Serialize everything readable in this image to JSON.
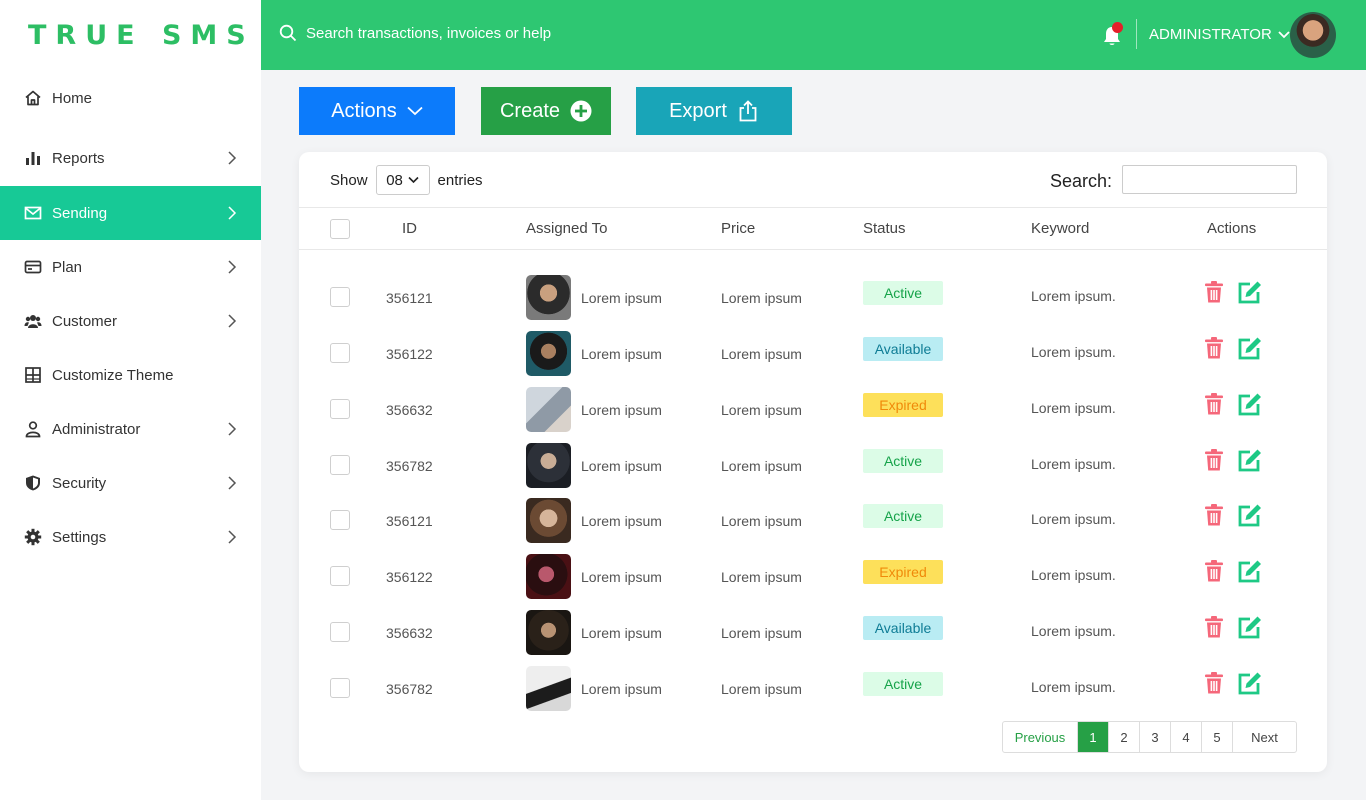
{
  "brand": "TRUE SMS",
  "sidebar": {
    "items": [
      {
        "label": "Home",
        "icon": "home-icon",
        "chevron": false
      },
      {
        "label": "Reports",
        "icon": "bar-chart-icon",
        "chevron": true
      },
      {
        "label": "Sending",
        "icon": "mail-icon",
        "chevron": true,
        "active": true
      },
      {
        "label": "Plan",
        "icon": "card-icon",
        "chevron": true
      },
      {
        "label": "Customer",
        "icon": "users-icon",
        "chevron": true
      },
      {
        "label": "Customize Theme",
        "icon": "grid-icon",
        "chevron": false
      },
      {
        "label": "Administrator",
        "icon": "user-icon",
        "chevron": true
      },
      {
        "label": "Security",
        "icon": "shield-icon",
        "chevron": true
      },
      {
        "label": "Settings",
        "icon": "gear-icon",
        "chevron": true
      }
    ]
  },
  "topbar": {
    "search_placeholder": "Search transactions, invoices or help",
    "user": "ADMINISTRATOR"
  },
  "toolbar": {
    "actions_label": "Actions",
    "create_label": "Create",
    "export_label": "Export"
  },
  "table": {
    "show_label": "Show",
    "entries_value": "08",
    "entries_label": "entries",
    "search_label": "Search:",
    "headers": {
      "id": "ID",
      "assigned": "Assigned To",
      "price": "Price",
      "status": "Status",
      "keyword": "Keyword",
      "actions": "Actions"
    },
    "rows": [
      {
        "id": "356121",
        "assigned": "Lorem ipsum",
        "price": "Lorem ipsum",
        "status": "Active",
        "keyword": "Lorem ipsum."
      },
      {
        "id": "356122",
        "assigned": "Lorem ipsum",
        "price": "Lorem ipsum",
        "status": "Available",
        "keyword": "Lorem ipsum."
      },
      {
        "id": "356632",
        "assigned": "Lorem ipsum",
        "price": "Lorem ipsum",
        "status": "Expired",
        "keyword": "Lorem ipsum."
      },
      {
        "id": "356782",
        "assigned": "Lorem ipsum",
        "price": "Lorem ipsum",
        "status": "Active",
        "keyword": "Lorem ipsum."
      },
      {
        "id": "356121",
        "assigned": "Lorem ipsum",
        "price": "Lorem ipsum",
        "status": "Active",
        "keyword": "Lorem ipsum."
      },
      {
        "id": "356122",
        "assigned": "Lorem ipsum",
        "price": "Lorem ipsum",
        "status": "Expired",
        "keyword": "Lorem ipsum."
      },
      {
        "id": "356632",
        "assigned": "Lorem ipsum",
        "price": "Lorem ipsum",
        "status": "Available",
        "keyword": "Lorem ipsum."
      },
      {
        "id": "356782",
        "assigned": "Lorem ipsum",
        "price": "Lorem ipsum",
        "status": "Active",
        "keyword": "Lorem ipsum."
      }
    ]
  },
  "pagination": {
    "previous": "Previous",
    "pages": [
      "1",
      "2",
      "3",
      "4",
      "5"
    ],
    "current": "1",
    "next": "Next"
  },
  "colors": {
    "brand_green": "#2dbe64",
    "topbar_green": "#2ec772",
    "active_nav": "#17c996",
    "actions_blue": "#0c7bfb",
    "create_green": "#26a046",
    "export_teal": "#19a5b8"
  }
}
